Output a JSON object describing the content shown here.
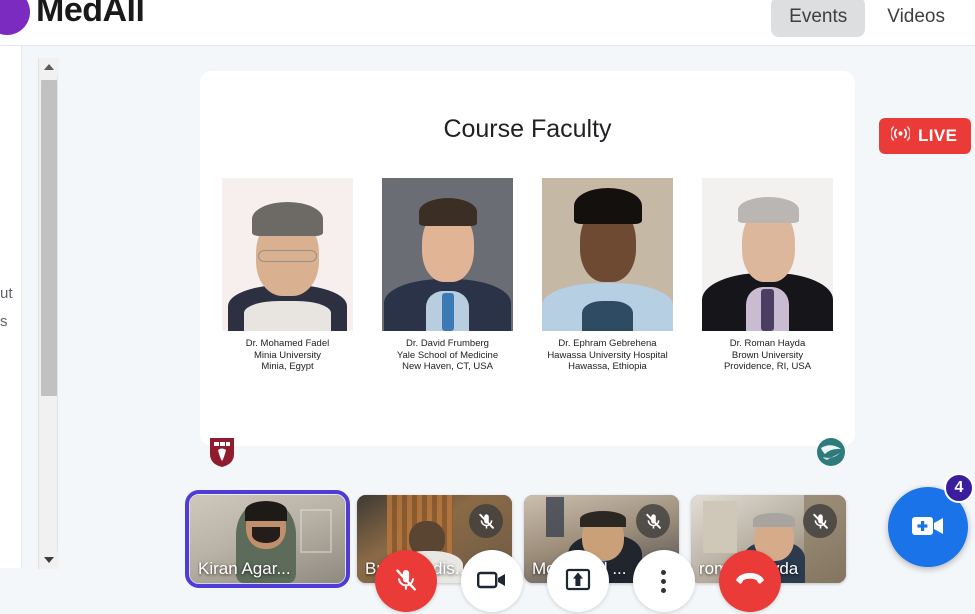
{
  "header": {
    "brand_name": "MedAll",
    "brand_icon": "medall-logo-icon",
    "nav": [
      {
        "label": "Events",
        "active": true
      },
      {
        "label": "Videos",
        "active": false
      }
    ]
  },
  "left_rail": {
    "clipped_fragments": [
      "ut",
      "s"
    ]
  },
  "scrollbar": {
    "up_arrow": "scroll-up-arrow-icon",
    "down_arrow": "scroll-down-arrow-icon"
  },
  "live_badge": {
    "label": "LIVE",
    "icon": "broadcast-icon",
    "color": "#ea3b38"
  },
  "slide": {
    "title": "Course Faculty",
    "faculty": [
      {
        "name": "Dr. Mohamed Fadel",
        "institution": "Minia University",
        "location": "Minia, Egypt"
      },
      {
        "name": "Dr. David Frumberg",
        "institution": "Yale School of Medicine",
        "location": "New Haven, CT, USA"
      },
      {
        "name": "Dr. Ephram Gebrehena",
        "institution": "Hawassa University Hospital",
        "location": "Hawassa, Ethiopia"
      },
      {
        "name": "Dr. Roman Hayda",
        "institution": "Brown University",
        "location": "Providence, RI, USA"
      }
    ],
    "logos": [
      {
        "name": "harvard-shield-logo",
        "color": "#8f1d2e"
      },
      {
        "name": "globe-swirl-logo",
        "color": "#2d7b7d"
      }
    ]
  },
  "filmstrip": [
    {
      "name": "Kiran Agar...",
      "muted": false,
      "active_speaker": true
    },
    {
      "name": "Brian Madis...",
      "muted": true,
      "active_speaker": false
    },
    {
      "name": "Mohamed ...",
      "muted": true,
      "active_speaker": false
    },
    {
      "name": "roman hayda",
      "muted": true,
      "active_speaker": false
    }
  ],
  "fab": {
    "icon": "add-video-icon",
    "badge_count": "4",
    "color": "#1a73e8",
    "badge_color": "#3b1e9e"
  },
  "controls": [
    {
      "name": "microphone-off-button",
      "icon": "mic-off-icon",
      "state": "muted"
    },
    {
      "name": "camera-button",
      "icon": "video-camera-icon",
      "state": "on"
    },
    {
      "name": "share-screen-button",
      "icon": "screen-share-icon",
      "state": "off"
    },
    {
      "name": "more-options-button",
      "icon": "kebab-menu-icon",
      "state": "off"
    },
    {
      "name": "end-call-button",
      "icon": "phone-hangup-icon",
      "state": "danger"
    }
  ],
  "colors": {
    "page_bg": "#f4f7fa",
    "active_speaker_border": "#4f3bd6",
    "brand_purple": "#7b2bbf"
  }
}
